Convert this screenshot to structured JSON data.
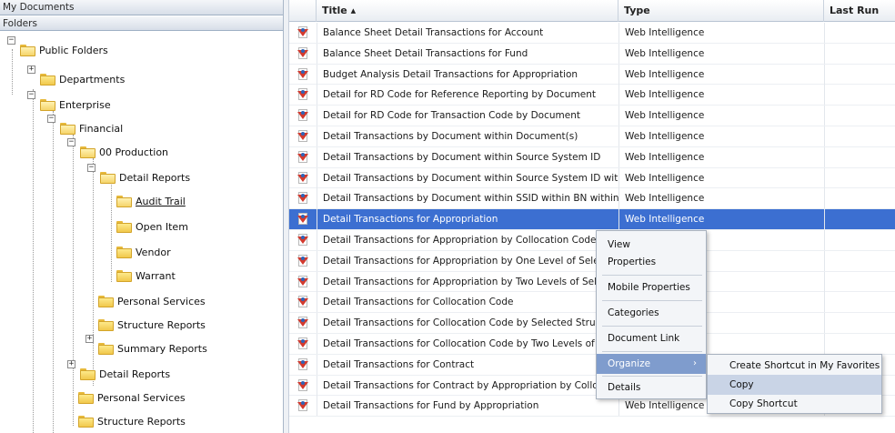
{
  "left_panel": {
    "my_documents_label": "My Documents",
    "folders_label": "Folders",
    "tree": [
      {
        "label": "Public Folders",
        "expander": "−"
      },
      {
        "label": "Departments",
        "expander": "+"
      },
      {
        "label": "Enterprise",
        "expander": "−"
      },
      {
        "label": "Financial",
        "expander": "−"
      },
      {
        "label": "00 Production",
        "expander": "−"
      },
      {
        "label": "Detail Reports",
        "expander": "−"
      },
      {
        "label": "Audit Trail",
        "expander": ""
      },
      {
        "label": "Open Item",
        "expander": ""
      },
      {
        "label": "Vendor",
        "expander": ""
      },
      {
        "label": "Warrant",
        "expander": ""
      },
      {
        "label": "Personal Services",
        "expander": ""
      },
      {
        "label": "Structure Reports",
        "expander": ""
      },
      {
        "label": "Summary Reports",
        "expander": "+"
      },
      {
        "label": "Detail Reports",
        "expander": "+"
      },
      {
        "label": "Personal Services",
        "expander": ""
      },
      {
        "label": "Structure Reports",
        "expander": ""
      }
    ]
  },
  "list": {
    "columns": {
      "title": "Title ▴",
      "type": "Type",
      "last_run": "Last Run"
    },
    "rows": [
      {
        "title": "Balance Sheet Detail Transactions for Account",
        "type": "Web Intelligence"
      },
      {
        "title": "Balance Sheet Detail Transactions for Fund",
        "type": "Web Intelligence"
      },
      {
        "title": "Budget Analysis Detail Transactions for Appropriation",
        "type": "Web Intelligence"
      },
      {
        "title": "Detail for RD Code for Reference Reporting by Document",
        "type": "Web Intelligence"
      },
      {
        "title": "Detail for RD Code for Transaction Code by Document",
        "type": "Web Intelligence"
      },
      {
        "title": "Detail Transactions by Document within Document(s)",
        "type": "Web Intelligence"
      },
      {
        "title": "Detail Transactions by Document within Source System ID",
        "type": "Web Intelligence"
      },
      {
        "title": "Detail Transactions by Document within Source System ID within Ba",
        "type": "Web Intelligence"
      },
      {
        "title": "Detail Transactions by Document within SSID within BN within Batch",
        "type": "Web Intelligence"
      },
      {
        "title": "Detail Transactions for Appropriation",
        "type": "Web Intelligence"
      },
      {
        "title": "Detail Transactions for Appropriation by Collocation Code b",
        "type": ""
      },
      {
        "title": "Detail Transactions for Appropriation by One Level of Selec",
        "type": ""
      },
      {
        "title": "Detail Transactions for Appropriation by Two Levels of Sele",
        "type": ""
      },
      {
        "title": "Detail Transactions for Collocation Code",
        "type": ""
      },
      {
        "title": "Detail Transactions for Collocation Code by Selected Struct",
        "type": ""
      },
      {
        "title": "Detail Transactions for Collocation Code by Two Levels of S",
        "type": ""
      },
      {
        "title": "Detail Transactions for Contract",
        "type": ""
      },
      {
        "title": "Detail Transactions for Contract by Appropriation by Colloc",
        "type": ""
      },
      {
        "title": "Detail Transactions for Fund by Appropriation",
        "type": "Web Intelligence"
      }
    ]
  },
  "context_menu": {
    "items": [
      "View",
      "Properties",
      "Mobile Properties",
      "Categories",
      "Document Link",
      "Organize",
      "Details"
    ],
    "submenu_arrow": "›"
  },
  "submenu": {
    "items": [
      "Create Shortcut in My Favorites",
      "Copy",
      "Copy Shortcut"
    ]
  },
  "colors": {
    "selection": "#3c6fd1",
    "menu_highlight": "#7f9ccd",
    "folder": "#f1c84b"
  }
}
